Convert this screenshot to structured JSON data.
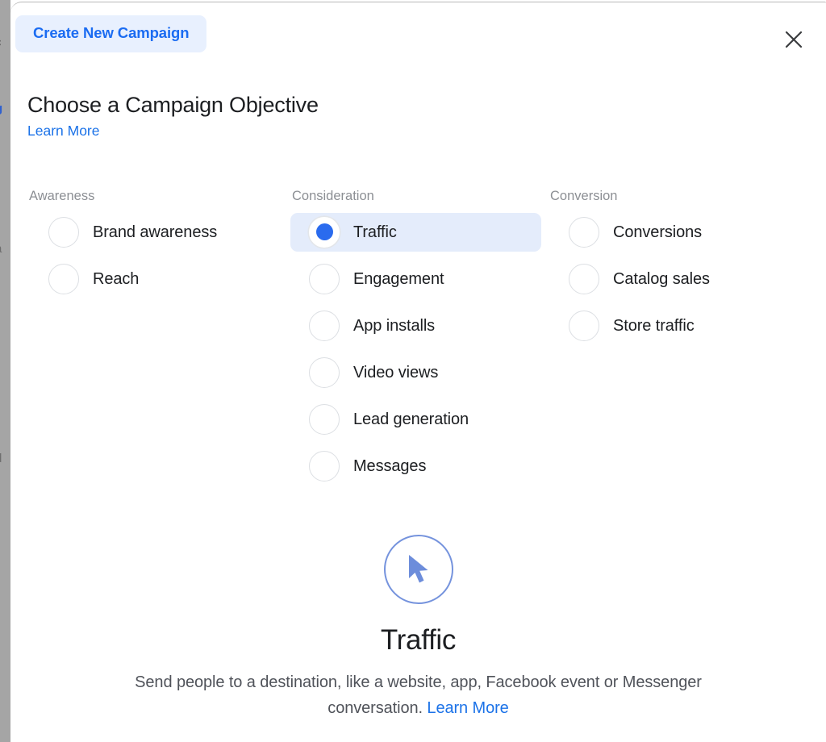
{
  "backdrop": {
    "ghost_fragments": [
      "c",
      "g",
      "a",
      "d"
    ]
  },
  "header": {
    "chip_label": "Create New Campaign",
    "close_icon": "close-icon"
  },
  "title": {
    "heading": "Choose a Campaign Objective",
    "learn_more_label": "Learn More"
  },
  "columns": [
    {
      "header": "Awareness",
      "options": [
        {
          "label": "Brand awareness",
          "selected": false
        },
        {
          "label": "Reach",
          "selected": false
        }
      ]
    },
    {
      "header": "Consideration",
      "options": [
        {
          "label": "Traffic",
          "selected": true
        },
        {
          "label": "Engagement",
          "selected": false
        },
        {
          "label": "App installs",
          "selected": false
        },
        {
          "label": "Video views",
          "selected": false
        },
        {
          "label": "Lead generation",
          "selected": false
        },
        {
          "label": "Messages",
          "selected": false
        }
      ]
    },
    {
      "header": "Conversion",
      "options": [
        {
          "label": "Conversions",
          "selected": false
        },
        {
          "label": "Catalog sales",
          "selected": false
        },
        {
          "label": "Store traffic",
          "selected": false
        }
      ]
    }
  ],
  "preview": {
    "icon": "cursor-arrow-icon",
    "title": "Traffic",
    "description": "Send people to a destination, like a website, app, Facebook event or Messenger conversation. ",
    "learn_more_label": "Learn More"
  },
  "colors": {
    "accent_blue": "#1b72e8",
    "chip_bg": "#e8f0fe",
    "chip_text": "#1b6cf2",
    "selected_row_bg": "#e4ecfb",
    "radio_checked": "#2a6bee",
    "preview_icon_stroke": "#7593dd",
    "text_primary": "#1c1e21",
    "text_muted": "#8c8f94"
  }
}
